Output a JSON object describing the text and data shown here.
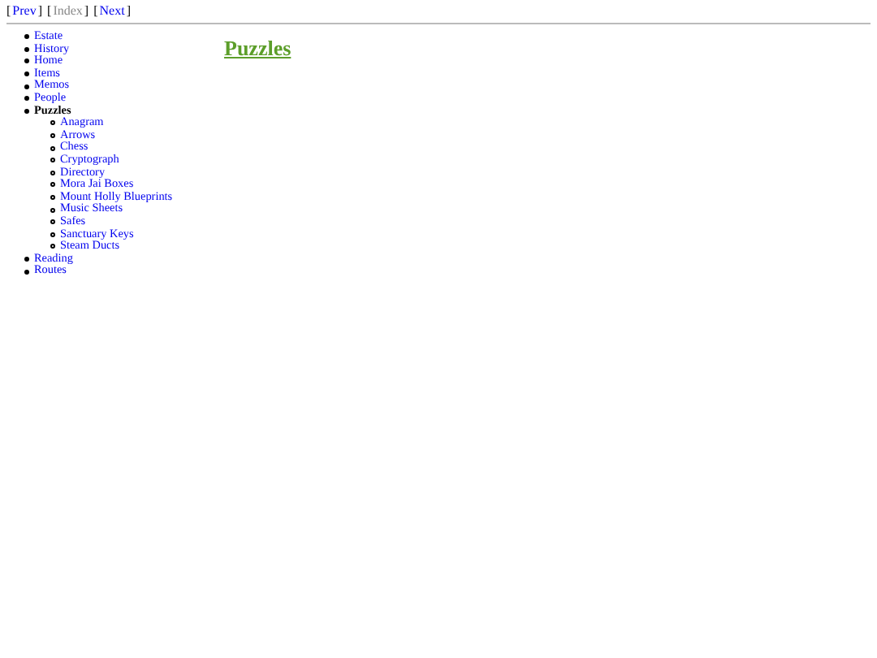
{
  "nav": [
    {
      "open": "[",
      "label": "Prev",
      "close": "]",
      "disabled": false
    },
    {
      "open": "[",
      "label": "Index",
      "close": "]",
      "disabled": true
    },
    {
      "open": "[",
      "label": "Next",
      "close": "]",
      "disabled": false
    }
  ],
  "sidebar": {
    "items": [
      {
        "label": "Estate",
        "selected": false
      },
      {
        "label": "History",
        "selected": false
      },
      {
        "label": "Home",
        "selected": false
      },
      {
        "label": "Items",
        "selected": false
      },
      {
        "label": "Memos",
        "selected": false
      },
      {
        "label": "People",
        "selected": false
      },
      {
        "label": "Puzzles",
        "selected": true,
        "children": [
          {
            "label": "Anagram",
            "selected": false
          },
          {
            "label": "Arrows",
            "selected": false
          },
          {
            "label": "Chess",
            "selected": false
          },
          {
            "label": "Cryptograph",
            "selected": false
          },
          {
            "label": "Directory",
            "selected": false
          },
          {
            "label": "Mora Jai Boxes",
            "selected": false
          },
          {
            "label": "Mount Holly Blueprints",
            "selected": false
          },
          {
            "label": "Music Sheets",
            "selected": false
          },
          {
            "label": "Safes",
            "selected": false
          },
          {
            "label": "Sanctuary Keys",
            "selected": false
          },
          {
            "label": "Steam Ducts",
            "selected": false
          }
        ]
      },
      {
        "label": "Reading",
        "selected": false
      },
      {
        "label": "Routes",
        "selected": false
      }
    ]
  },
  "heading": "Puzzles"
}
